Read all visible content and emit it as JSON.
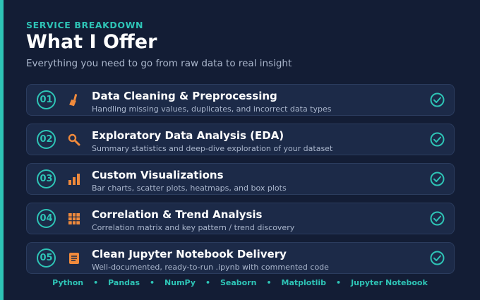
{
  "header": {
    "eyebrow": "SERVICE BREAKDOWN",
    "title": "What I Offer",
    "subtitle": "Everything you need to go from raw data to real insight"
  },
  "colors": {
    "background": "#131d35",
    "accent": "#2ec4b6",
    "icon_orange": "#f08a3c",
    "card_bg": "#1c2a48"
  },
  "services": [
    {
      "number": "01",
      "icon": "broom-icon",
      "title": "Data Cleaning & Preprocessing",
      "description": "Handling missing values, duplicates, and incorrect data types"
    },
    {
      "number": "02",
      "icon": "magnifier-icon",
      "title": "Exploratory Data Analysis (EDA)",
      "description": "Summary statistics and deep-dive exploration of your dataset"
    },
    {
      "number": "03",
      "icon": "bar-chart-icon",
      "title": "Custom Visualizations",
      "description": "Bar charts, scatter plots, heatmaps, and box plots"
    },
    {
      "number": "04",
      "icon": "grid-icon",
      "title": "Correlation & Trend Analysis",
      "description": "Correlation matrix and key pattern / trend discovery"
    },
    {
      "number": "05",
      "icon": "notebook-icon",
      "title": "Clean Jupyter Notebook Delivery",
      "description": "Well-documented, ready-to-run .ipynb with commented code"
    }
  ],
  "tech_stack": [
    "Python",
    "Pandas",
    "NumPy",
    "Seaborn",
    "Matplotlib",
    "Jupyter Notebook"
  ]
}
